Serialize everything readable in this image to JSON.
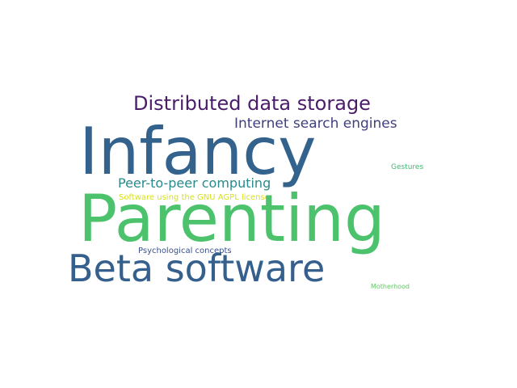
{
  "words": [
    {
      "text": "Distributed data storage",
      "color": "#4a1c6a"
    },
    {
      "text": "Internet search engines",
      "color": "#3f3f7e"
    },
    {
      "text": "Infancy",
      "color": "#33638d"
    },
    {
      "text": "Gestures",
      "color": "#3fbc73"
    },
    {
      "text": "Peer-to-peer computing",
      "color": "#2a8a8b"
    },
    {
      "text": "Software using the GNU AGPL license",
      "color": "#d8e219"
    },
    {
      "text": "Parenting",
      "color": "#4cc26c"
    },
    {
      "text": "Psychological concepts",
      "color": "#3b528b"
    },
    {
      "text": "Beta software",
      "color": "#355f8d"
    },
    {
      "text": "Motherhood",
      "color": "#5ec962"
    }
  ]
}
